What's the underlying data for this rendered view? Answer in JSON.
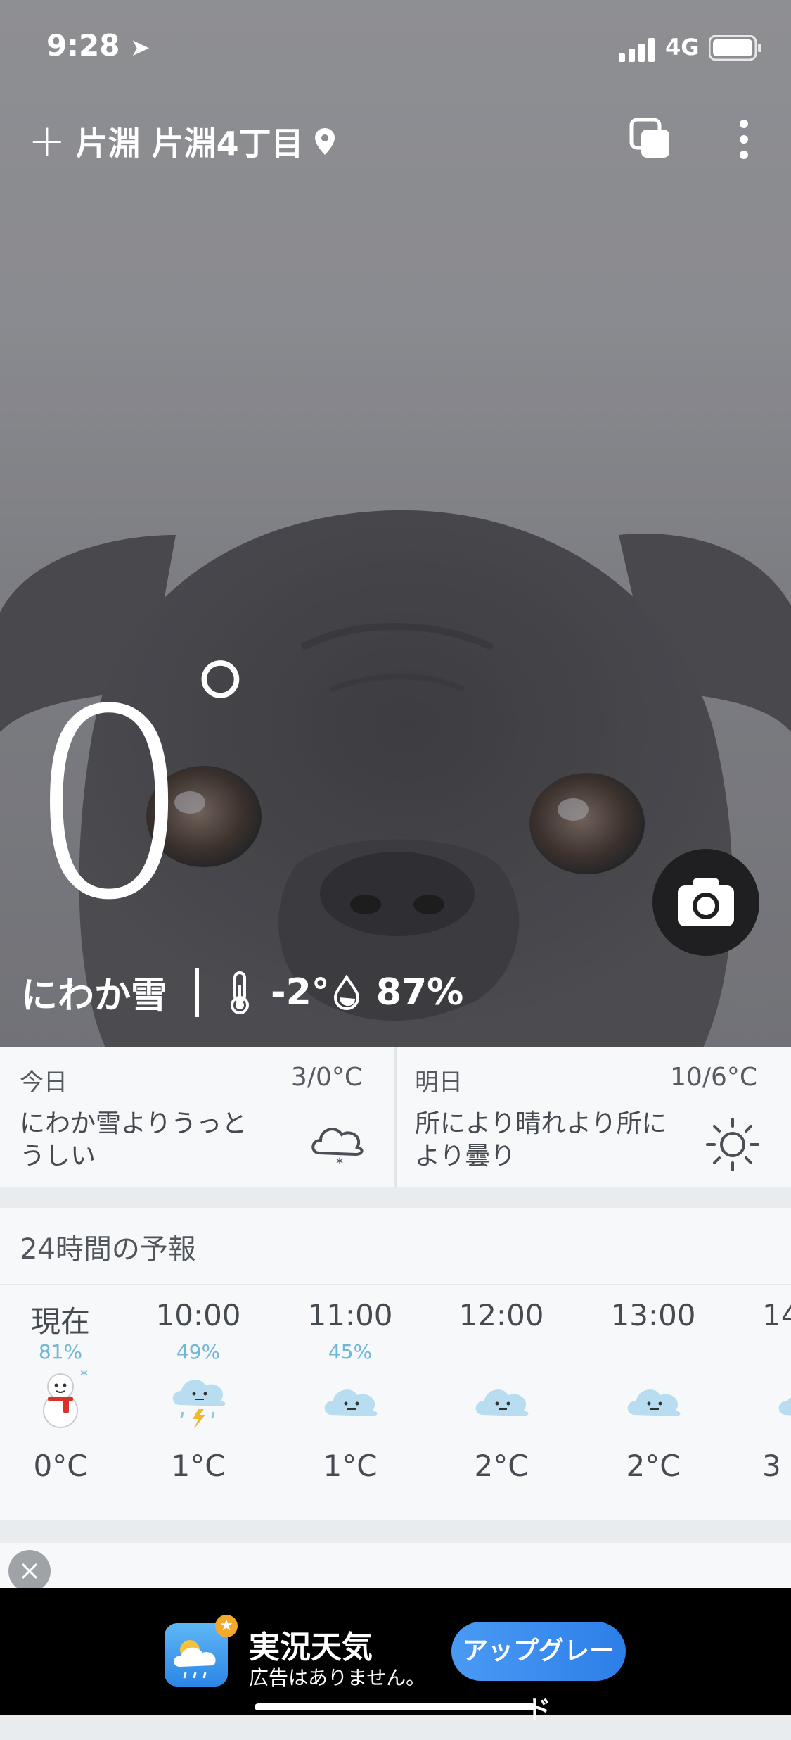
{
  "status_bar": {
    "time": "9:28",
    "network": "4G"
  },
  "location": {
    "name": "片淵 片淵4丁目"
  },
  "current": {
    "temperature": "0",
    "degree": "°",
    "condition": "にわか雪",
    "feels_like": "-2°",
    "humidity": "87%"
  },
  "today": {
    "label": "今日",
    "temps": "3/0°C",
    "summary": "にわか雪よりうっと\nうしい",
    "icon": "snow-cloud-icon"
  },
  "tomorrow": {
    "label": "明日",
    "temps": "10/6°C",
    "summary": "所により晴れより所に\nより曇り",
    "icon": "sun-icon"
  },
  "hourly": {
    "title": "24時間の予報",
    "items": [
      {
        "time": "現在",
        "precip": "81%",
        "icon": "snowman-icon",
        "temp": "0°C"
      },
      {
        "time": "10:00",
        "precip": "49%",
        "icon": "thunder-rain-cloud-icon",
        "temp": "1°C"
      },
      {
        "time": "11:00",
        "precip": "45%",
        "icon": "cloud-icon",
        "temp": "1°C"
      },
      {
        "time": "12:00",
        "precip": "",
        "icon": "cloud-icon",
        "temp": "2°C"
      },
      {
        "time": "13:00",
        "precip": "",
        "icon": "cloud-icon",
        "temp": "2°C"
      },
      {
        "time": "14",
        "precip": "",
        "icon": "cloud-icon",
        "temp": "3"
      }
    ]
  },
  "ad": {
    "app_name": "実況天気",
    "subtitle": "広告はありません。",
    "button": "アップグレード"
  },
  "colors": {
    "accent": "#3a8ef0",
    "precip": "#6fb7d6"
  }
}
